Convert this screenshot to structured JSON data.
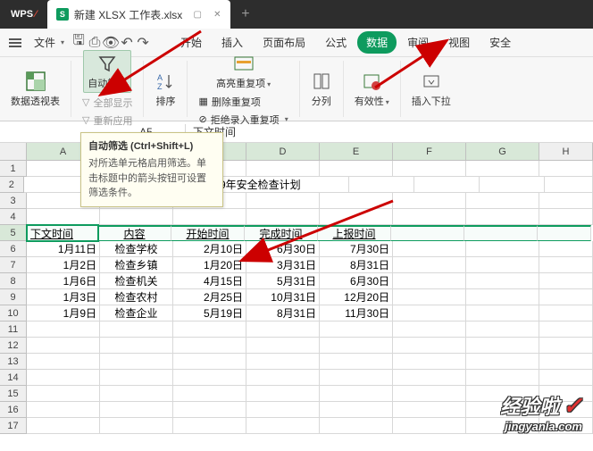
{
  "app": {
    "name": "WPS",
    "tab_title": "新建 XLSX 工作表.xlsx"
  },
  "menu": {
    "file": "文件",
    "items": [
      "开始",
      "插入",
      "页面布局",
      "公式",
      "数据",
      "审阅",
      "视图",
      "安全"
    ],
    "active_index": 4
  },
  "ribbon": {
    "pivot": "数据透视表",
    "filter": "自动筛选",
    "show_all": "全部显示",
    "reapply": "重新应用",
    "sort": "排序",
    "highlight_dup": "高亮重复项",
    "del_dup": "删除重复项",
    "reject_dup": "拒绝录入重复项",
    "split": "分列",
    "validity": "有效性",
    "insert_dropdown": "插入下拉"
  },
  "tooltip": {
    "title": "自动筛选 (Ctrl+Shift+L)",
    "body": "对所选单元格启用筛选。单击标题中的箭头按钮可设置筛选条件。"
  },
  "cellref": "A5",
  "fx_value": "下文时间",
  "sheet": {
    "title": "2019年安全检查计划",
    "cols": [
      "A",
      "B",
      "C",
      "D",
      "E",
      "F",
      "G",
      "H"
    ],
    "headers": [
      "下文时间",
      "内容",
      "开始时间",
      "完成时间",
      "上报时间"
    ],
    "rows": [
      [
        "1月11日",
        "检查学校",
        "2月10日",
        "6月30日",
        "7月30日"
      ],
      [
        "1月2日",
        "检查乡镇",
        "1月20日",
        "3月31日",
        "8月31日"
      ],
      [
        "1月6日",
        "检查机关",
        "4月15日",
        "5月31日",
        "6月30日"
      ],
      [
        "1月3日",
        "检查农村",
        "2月25日",
        "10月31日",
        "12月20日"
      ],
      [
        "1月9日",
        "检查企业",
        "5月19日",
        "8月31日",
        "11月30日"
      ]
    ]
  },
  "watermark": {
    "main": "经验啦",
    "sub": "jingyanla.com"
  }
}
